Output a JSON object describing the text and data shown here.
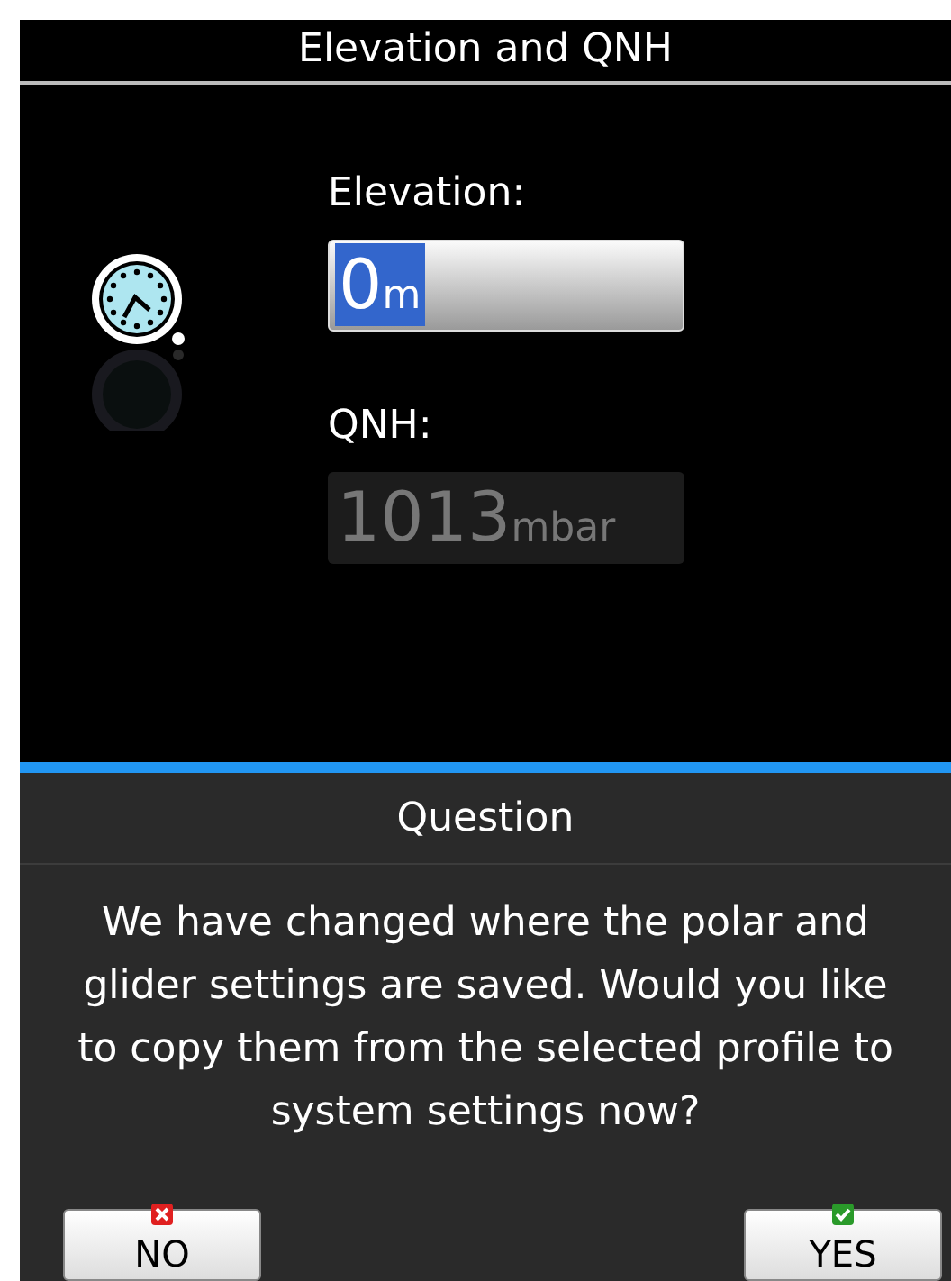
{
  "window": {
    "title": "Elevation and QNH"
  },
  "fields": [
    {
      "label": "Elevation:",
      "value": "0",
      "unit": "m",
      "focused": true,
      "disabled": false
    },
    {
      "label": "QNH:",
      "value": "1013",
      "unit": "mbar",
      "focused": false,
      "disabled": true
    }
  ],
  "dialog": {
    "title": "Question",
    "message": "We have changed where the polar and glider settings are saved. Would you like to copy them from the selected profile to system settings now?",
    "buttons": [
      {
        "label": "NO",
        "kind": "no"
      },
      {
        "label": "YES",
        "kind": "yes"
      }
    ]
  }
}
